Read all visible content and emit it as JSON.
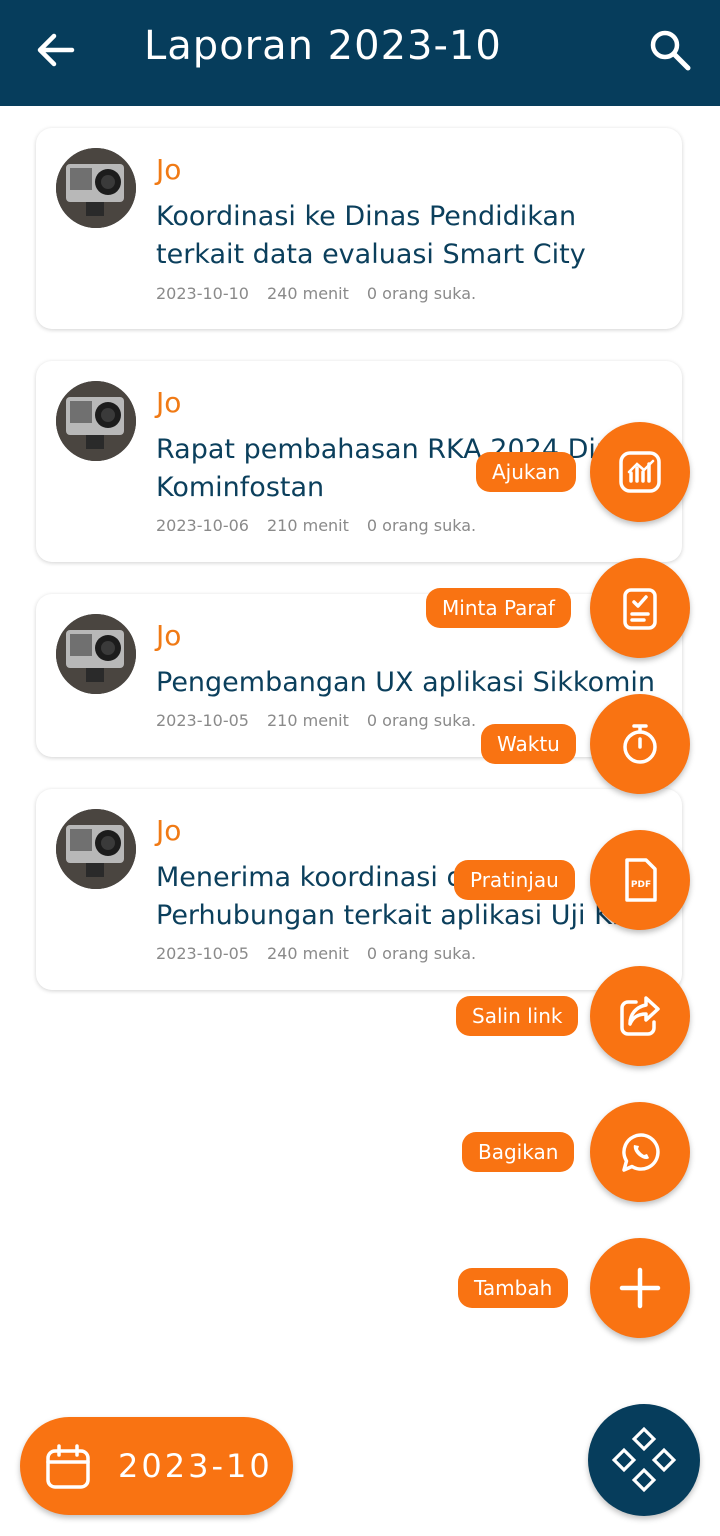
{
  "header": {
    "title": "Laporan 2023-10",
    "back_icon": "arrow-left-icon",
    "search_icon": "search-icon"
  },
  "reports": [
    {
      "author": "Jo",
      "title": "Koordinasi ke Dinas Pendidikan terkait data evaluasi Smart City",
      "title_line1": "Koordinasi ke Dinas Pendidikan",
      "title_line2": "terkait data evaluasi Smart City",
      "date": "2023-10-10",
      "duration": "240 menit",
      "likes": "0 orang suka."
    },
    {
      "author": "Jo",
      "title": "Rapat pembahasan RKA 2024 Dinas Kominfostan",
      "title_line1": "Rapat pembahasan RKA 2024 Din",
      "title_line2": "Kominfostan",
      "date": "2023-10-06",
      "duration": "210 menit",
      "likes": "0 orang suka."
    },
    {
      "author": "Jo",
      "title": "Pengembangan UX aplikasi Sikkomin",
      "title_line1": "Pengembangan UX aplikasi Sikkomin",
      "title_line2": "",
      "date": "2023-10-05",
      "duration": "210 menit",
      "likes": "0 orang suka."
    },
    {
      "author": "Jo",
      "title": "Menerima koordinasi dari Dinas Perhubungan terkait aplikasi Uji KIR",
      "title_line1": "Menerima koordinasi d",
      "title_line2": "Perhubungan terkait aplikasi Uji Ki",
      "date": "2023-10-05",
      "duration": "240 menit",
      "likes": "0 orang suka."
    }
  ],
  "speed_dial": [
    {
      "label": "Ajukan",
      "icon": "chart-report-icon"
    },
    {
      "label": "Minta Paraf",
      "icon": "clipboard-check-icon"
    },
    {
      "label": "Waktu",
      "icon": "stopwatch-icon"
    },
    {
      "label": "Pratinjau",
      "icon": "pdf-icon"
    },
    {
      "label": "Salin link",
      "icon": "share-icon"
    },
    {
      "label": "Bagikan",
      "icon": "whatsapp-icon"
    },
    {
      "label": "Tambah",
      "icon": "plus-icon"
    }
  ],
  "pdf_icon_text": "PDF",
  "period": {
    "label": "2023-10",
    "icon": "calendar-icon"
  },
  "menu_button": {
    "icon": "menu-diamond-icon"
  },
  "colors": {
    "primary": "#063d5c",
    "accent": "#f97312",
    "author": "#f07a15",
    "title_text": "#0b3f5c",
    "meta": "#8a8a8a"
  }
}
